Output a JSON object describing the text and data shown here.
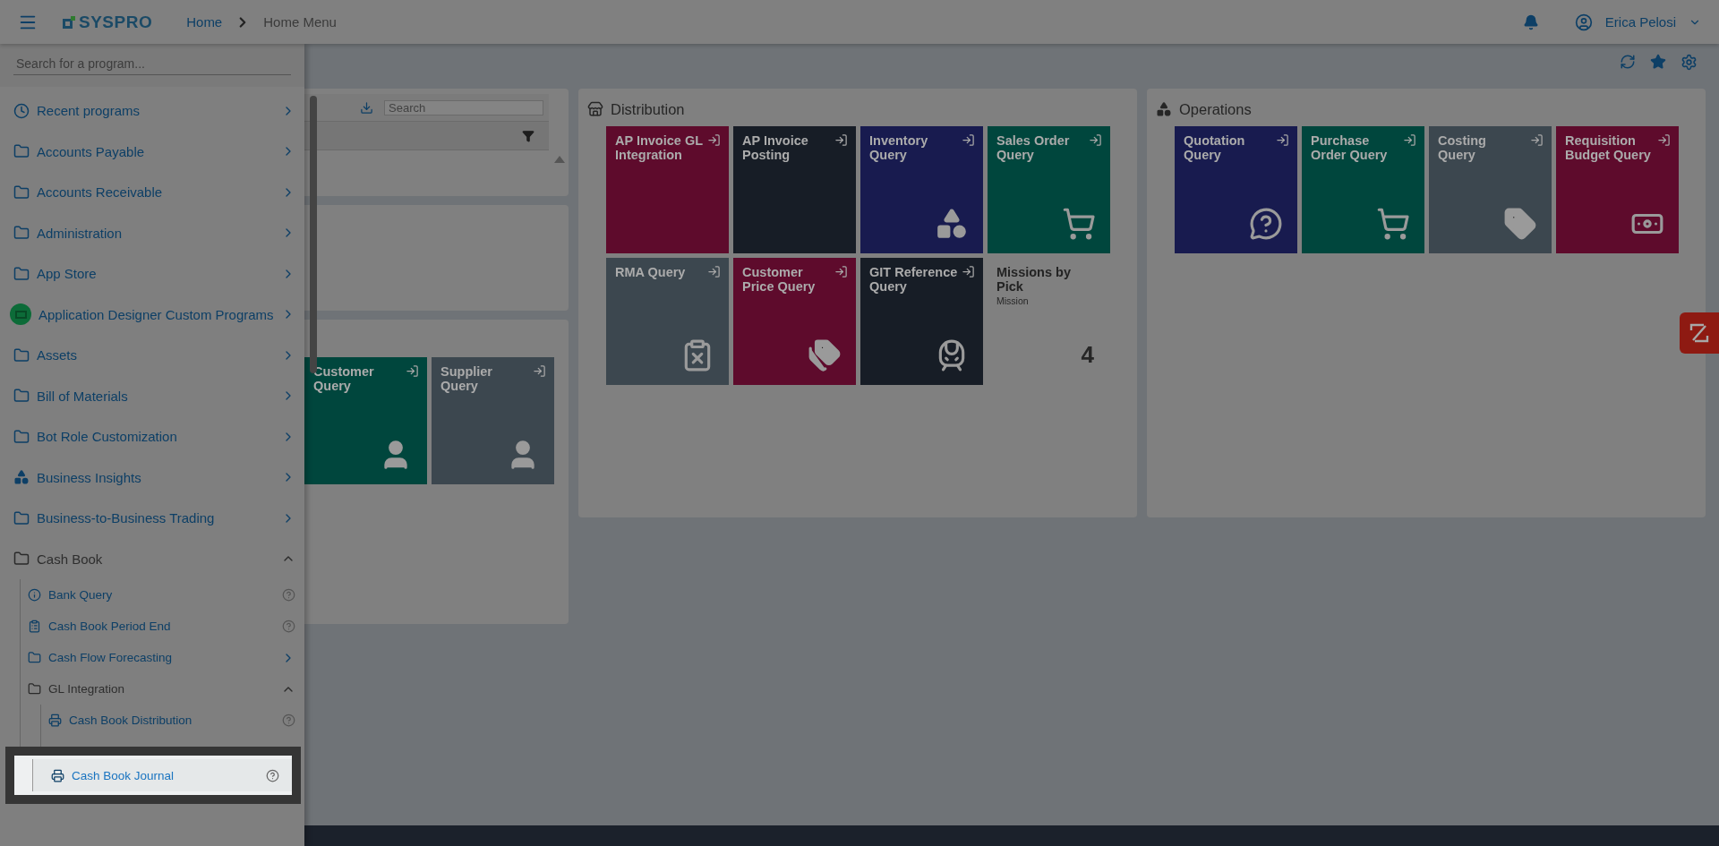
{
  "header": {
    "logo": "SYSPRO",
    "breadcrumb": [
      {
        "kind": "link",
        "label": "Home"
      },
      {
        "kind": "current",
        "label": "Home Menu"
      }
    ],
    "user": "Erica Pelosi"
  },
  "sidebar": {
    "search": {
      "placeholder": "Search for a program..."
    },
    "items": [
      {
        "kind": "recent",
        "label": "Recent programs",
        "expanded": false
      },
      {
        "kind": "folder",
        "label": "Accounts Payable",
        "expanded": false
      },
      {
        "kind": "folder",
        "label": "Accounts Receivable",
        "expanded": false
      },
      {
        "kind": "folder",
        "label": "Administration",
        "expanded": false
      },
      {
        "kind": "folder",
        "label": "App Store",
        "expanded": false
      },
      {
        "kind": "custom",
        "label": "Application Designer Custom Programs",
        "expanded": false
      },
      {
        "kind": "folder",
        "label": "Assets",
        "expanded": false
      },
      {
        "kind": "folder",
        "label": "Bill of Materials",
        "expanded": false
      },
      {
        "kind": "folder",
        "label": "Bot Role Customization",
        "expanded": false
      },
      {
        "kind": "insights",
        "label": "Business Insights",
        "expanded": false
      },
      {
        "kind": "folder",
        "label": "Business-to-Business Trading",
        "expanded": false
      },
      {
        "kind": "folder",
        "label": "Cash Book",
        "expanded": true,
        "children": [
          {
            "kind": "query",
            "label": "Bank Query"
          },
          {
            "kind": "period",
            "label": "Cash Book Period End"
          },
          {
            "kind": "folder",
            "label": "Cash Flow Forecasting",
            "expanded": false
          },
          {
            "kind": "folder",
            "label": "GL Integration",
            "expanded": true,
            "children": [
              {
                "kind": "print",
                "label": "Cash Book Distribution",
                "highlighted": false
              },
              {
                "kind": "print",
                "label": "Cash Book Journal",
                "highlighted": true
              }
            ]
          }
        ]
      }
    ]
  },
  "left_panel": {
    "search": {
      "placeholder": "Search"
    },
    "tiles": [
      {
        "kind": "person",
        "title": "Customer Query",
        "color": "#00463d"
      },
      {
        "kind": "person",
        "title": "Supplier Query",
        "color": "#3c474f"
      }
    ]
  },
  "sections": [
    {
      "kind": "store",
      "title": "Distribution",
      "tiles": [
        {
          "kind": "none",
          "title": "AP Invoice GL Integration",
          "color": "#5e0b2c"
        },
        {
          "kind": "none",
          "title": "AP Invoice Posting",
          "color": "#171d26"
        },
        {
          "kind": "widgets",
          "title": "Inventory Query",
          "color": "#181b4f"
        },
        {
          "kind": "cart",
          "title": "Sales Order Query",
          "color": "#00463d"
        },
        {
          "kind": "return",
          "title": "RMA Query",
          "color": "#3c474f"
        },
        {
          "kind": "tags",
          "title": "Customer Price Query",
          "color": "#5e0b2c"
        },
        {
          "kind": "train",
          "title": "GIT Reference Query",
          "color": "#171d26"
        },
        {
          "kind": "kpi",
          "title": "Missions by Pick",
          "subtitle": "Mission",
          "value": "4"
        }
      ]
    },
    {
      "kind": "widgets",
      "title": "Operations",
      "tiles": [
        {
          "kind": "question",
          "title": "Quotation Query",
          "color": "#181b4f"
        },
        {
          "kind": "cart",
          "title": "Purchase Order Query",
          "color": "#00463d"
        },
        {
          "kind": "tag",
          "title": "Costing Query",
          "color": "#3c474f"
        },
        {
          "kind": "money",
          "title": "Requisition Budget Query",
          "color": "#5e0b2c"
        }
      ]
    }
  ]
}
